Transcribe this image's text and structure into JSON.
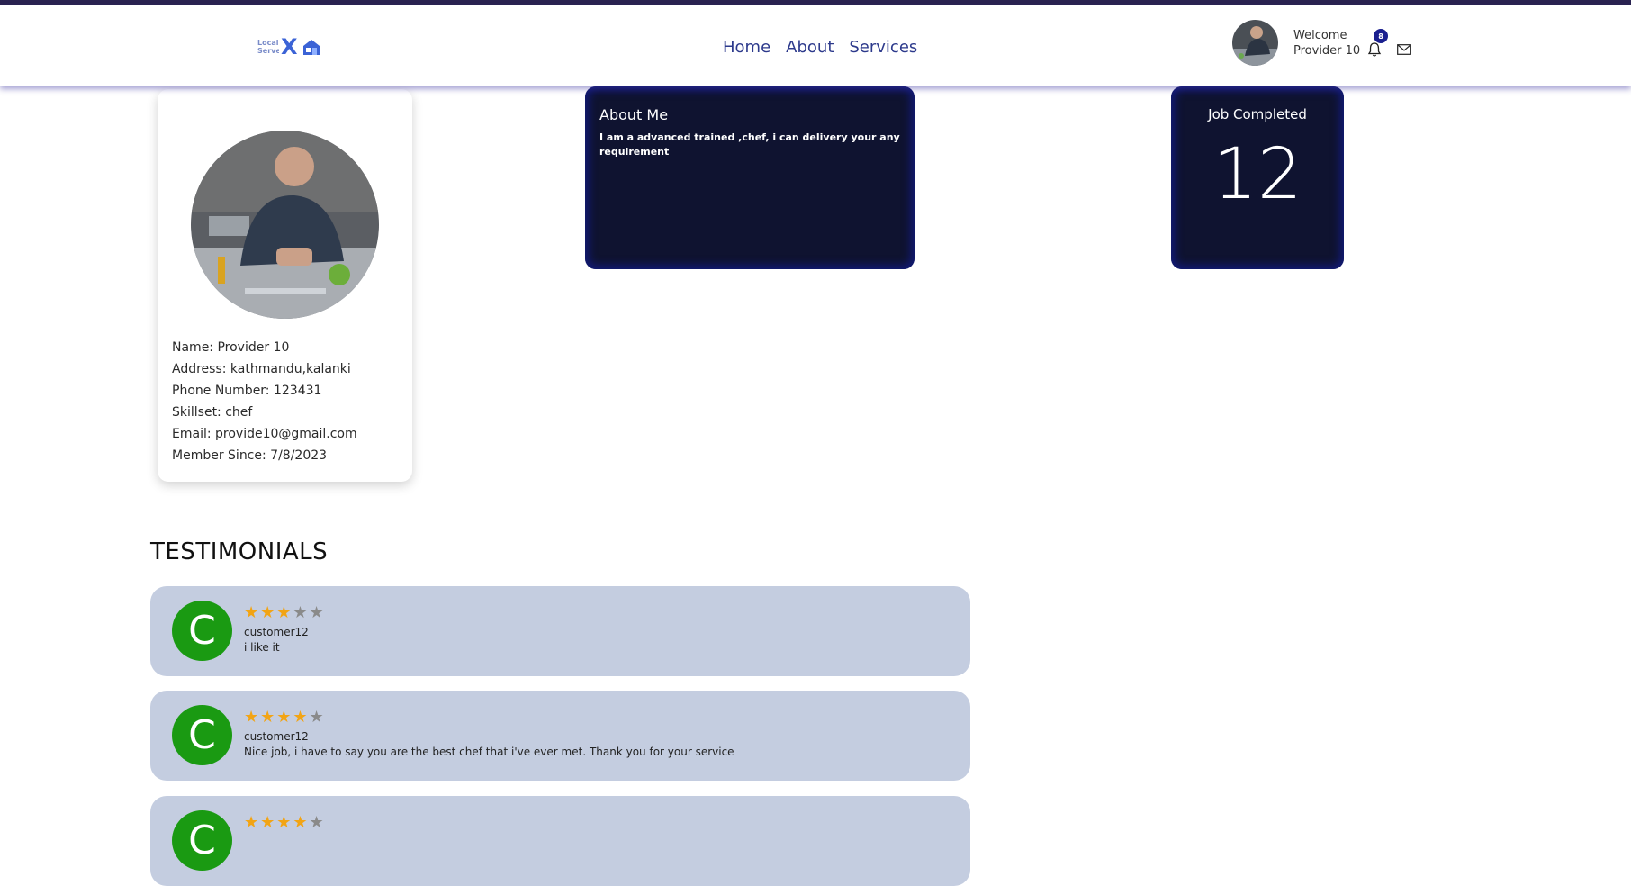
{
  "header": {
    "logo_text": "Local Serve",
    "logo_x": "X",
    "nav": [
      "Home",
      "About",
      "Services"
    ],
    "welcome_line1": "Welcome",
    "welcome_line2": "Provider 10",
    "notification_count": "8",
    "icons": [
      "bell-icon",
      "mail-icon",
      "house-icon"
    ]
  },
  "profile": {
    "name": "Name: Provider 10",
    "address": "Address: kathmandu,kalanki",
    "phone": "Phone Number: 123431",
    "skillset": "Skillset: chef",
    "email": "Email: provide10@gmail.com",
    "member_since": "Member Since: 7/8/2023"
  },
  "about": {
    "title": "About Me",
    "text": "I am a advanced trained ,chef, i can delivery your any requirement"
  },
  "jobs": {
    "title": "Job Completed",
    "count": "12"
  },
  "testimonials": {
    "heading": "TESTIMONIALS",
    "items": [
      {
        "initial": "C",
        "rating": 3,
        "stars": "★★★",
        "stars_off": "★★",
        "name": "customer12",
        "comment": "i like it"
      },
      {
        "initial": "C",
        "rating": 4,
        "stars": "★★★★",
        "stars_off": "★",
        "name": "customer12",
        "comment": "Nice job, i have to say you are the best chef that i've ever met. Thank you for your service"
      },
      {
        "initial": "C",
        "rating": 4,
        "stars": "★★★★",
        "stars_off": "★",
        "name": "",
        "comment": ""
      }
    ]
  },
  "colors": {
    "accent": "#2d3a8c",
    "dark_card": "#0f1330",
    "star": "#f2a414",
    "avatar_green": "#1a9a12",
    "testimonial_bg": "#c4cde0"
  }
}
